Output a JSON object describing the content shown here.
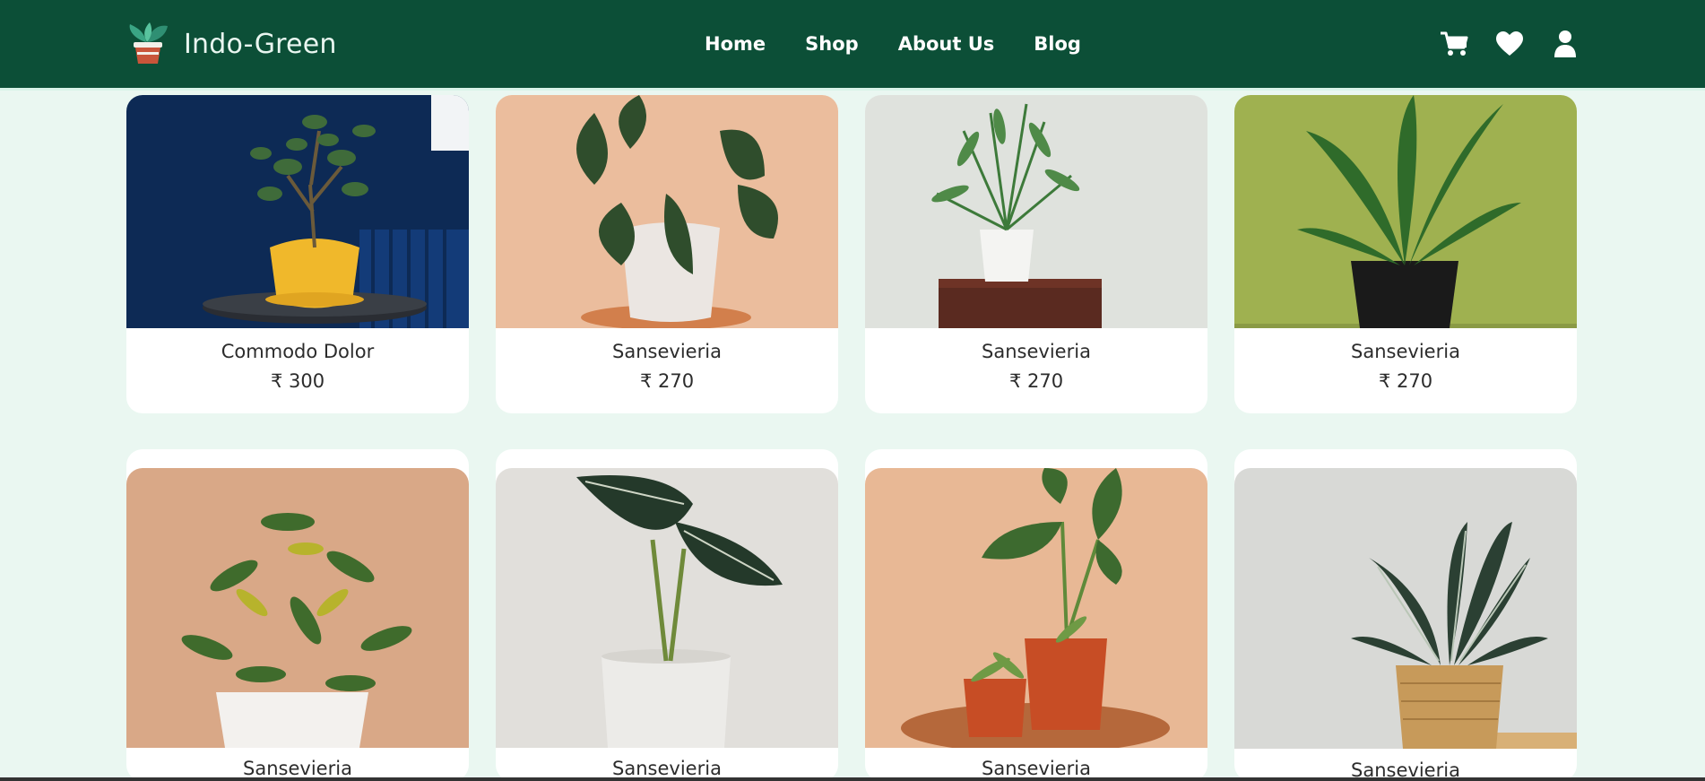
{
  "brand": {
    "name": "Indo-Green",
    "logo_icon": "potted-plant-logo"
  },
  "nav": {
    "items": [
      {
        "label": "Home"
      },
      {
        "label": "Shop"
      },
      {
        "label": "About Us"
      },
      {
        "label": "Blog"
      }
    ],
    "icons": [
      "cart-icon",
      "heart-icon",
      "user-icon"
    ]
  },
  "colors": {
    "header": "#0c4f37",
    "page_bg": "#eaf7f1",
    "card_bg": "#ffffff"
  },
  "products": [
    {
      "name": "Commodo Dolor",
      "price": "₹ 300"
    },
    {
      "name": "Sansevieria",
      "price": "₹ 270"
    },
    {
      "name": "Sansevieria",
      "price": "₹ 270"
    },
    {
      "name": "Sansevieria",
      "price": "₹ 270"
    },
    {
      "name": "Sansevieria",
      "price": ""
    },
    {
      "name": "Sansevieria",
      "price": ""
    },
    {
      "name": "Sansevieria",
      "price": ""
    },
    {
      "name": "Sansevieria",
      "price": ""
    }
  ]
}
